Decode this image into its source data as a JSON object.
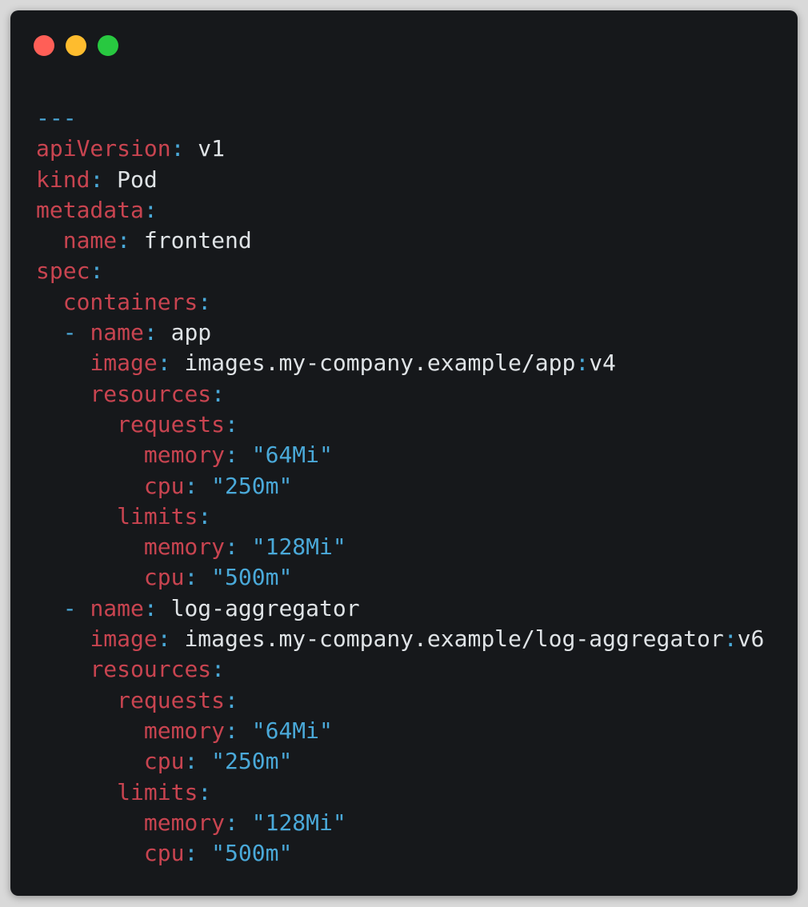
{
  "window": {
    "controls": [
      {
        "name": "close",
        "color": "#ff5f57"
      },
      {
        "name": "minimize",
        "color": "#febc2e"
      },
      {
        "name": "maximize",
        "color": "#28c840"
      }
    ]
  },
  "colors": {
    "background": "#16181b",
    "key": "#c84450",
    "punctuation": "#4aa9d9",
    "string": "#4aa9d9",
    "plain": "#dfe3e6"
  },
  "code": {
    "lines": [
      {
        "indent": "",
        "segments": [
          {
            "t": "punct",
            "v": "---"
          }
        ]
      },
      {
        "indent": "",
        "segments": [
          {
            "t": "key",
            "v": "apiVersion"
          },
          {
            "t": "punct",
            "v": ":"
          },
          {
            "t": "val",
            "v": " v1"
          }
        ]
      },
      {
        "indent": "",
        "segments": [
          {
            "t": "key",
            "v": "kind"
          },
          {
            "t": "punct",
            "v": ":"
          },
          {
            "t": "val",
            "v": " Pod"
          }
        ]
      },
      {
        "indent": "",
        "segments": [
          {
            "t": "key",
            "v": "metadata"
          },
          {
            "t": "punct",
            "v": ":"
          }
        ]
      },
      {
        "indent": "  ",
        "segments": [
          {
            "t": "key",
            "v": "name"
          },
          {
            "t": "punct",
            "v": ":"
          },
          {
            "t": "val",
            "v": " frontend"
          }
        ]
      },
      {
        "indent": "",
        "segments": [
          {
            "t": "key",
            "v": "spec"
          },
          {
            "t": "punct",
            "v": ":"
          }
        ]
      },
      {
        "indent": "  ",
        "segments": [
          {
            "t": "key",
            "v": "containers"
          },
          {
            "t": "punct",
            "v": ":"
          }
        ]
      },
      {
        "indent": "  ",
        "segments": [
          {
            "t": "punct",
            "v": "- "
          },
          {
            "t": "key",
            "v": "name"
          },
          {
            "t": "punct",
            "v": ":"
          },
          {
            "t": "val",
            "v": " app"
          }
        ]
      },
      {
        "indent": "    ",
        "segments": [
          {
            "t": "key",
            "v": "image"
          },
          {
            "t": "punct",
            "v": ":"
          },
          {
            "t": "val",
            "v": " images.my-company.example/app"
          },
          {
            "t": "punct",
            "v": ":"
          },
          {
            "t": "val",
            "v": "v4"
          }
        ]
      },
      {
        "indent": "    ",
        "segments": [
          {
            "t": "key",
            "v": "resources"
          },
          {
            "t": "punct",
            "v": ":"
          }
        ]
      },
      {
        "indent": "      ",
        "segments": [
          {
            "t": "key",
            "v": "requests"
          },
          {
            "t": "punct",
            "v": ":"
          }
        ]
      },
      {
        "indent": "        ",
        "segments": [
          {
            "t": "key",
            "v": "memory"
          },
          {
            "t": "punct",
            "v": ":"
          },
          {
            "t": "str",
            "v": " \"64Mi\""
          }
        ]
      },
      {
        "indent": "        ",
        "segments": [
          {
            "t": "key",
            "v": "cpu"
          },
          {
            "t": "punct",
            "v": ":"
          },
          {
            "t": "str",
            "v": " \"250m\""
          }
        ]
      },
      {
        "indent": "      ",
        "segments": [
          {
            "t": "key",
            "v": "limits"
          },
          {
            "t": "punct",
            "v": ":"
          }
        ]
      },
      {
        "indent": "        ",
        "segments": [
          {
            "t": "key",
            "v": "memory"
          },
          {
            "t": "punct",
            "v": ":"
          },
          {
            "t": "str",
            "v": " \"128Mi\""
          }
        ]
      },
      {
        "indent": "        ",
        "segments": [
          {
            "t": "key",
            "v": "cpu"
          },
          {
            "t": "punct",
            "v": ":"
          },
          {
            "t": "str",
            "v": " \"500m\""
          }
        ]
      },
      {
        "indent": "  ",
        "segments": [
          {
            "t": "punct",
            "v": "- "
          },
          {
            "t": "key",
            "v": "name"
          },
          {
            "t": "punct",
            "v": ":"
          },
          {
            "t": "val",
            "v": " log-aggregator"
          }
        ]
      },
      {
        "indent": "    ",
        "segments": [
          {
            "t": "key",
            "v": "image"
          },
          {
            "t": "punct",
            "v": ":"
          },
          {
            "t": "val",
            "v": " images.my-company.example/log-aggregator"
          },
          {
            "t": "punct",
            "v": ":"
          },
          {
            "t": "val",
            "v": "v6"
          }
        ]
      },
      {
        "indent": "    ",
        "segments": [
          {
            "t": "key",
            "v": "resources"
          },
          {
            "t": "punct",
            "v": ":"
          }
        ]
      },
      {
        "indent": "      ",
        "segments": [
          {
            "t": "key",
            "v": "requests"
          },
          {
            "t": "punct",
            "v": ":"
          }
        ]
      },
      {
        "indent": "        ",
        "segments": [
          {
            "t": "key",
            "v": "memory"
          },
          {
            "t": "punct",
            "v": ":"
          },
          {
            "t": "str",
            "v": " \"64Mi\""
          }
        ]
      },
      {
        "indent": "        ",
        "segments": [
          {
            "t": "key",
            "v": "cpu"
          },
          {
            "t": "punct",
            "v": ":"
          },
          {
            "t": "str",
            "v": " \"250m\""
          }
        ]
      },
      {
        "indent": "      ",
        "segments": [
          {
            "t": "key",
            "v": "limits"
          },
          {
            "t": "punct",
            "v": ":"
          }
        ]
      },
      {
        "indent": "        ",
        "segments": [
          {
            "t": "key",
            "v": "memory"
          },
          {
            "t": "punct",
            "v": ":"
          },
          {
            "t": "str",
            "v": " \"128Mi\""
          }
        ]
      },
      {
        "indent": "        ",
        "segments": [
          {
            "t": "key",
            "v": "cpu"
          },
          {
            "t": "punct",
            "v": ":"
          },
          {
            "t": "str",
            "v": " \"500m\""
          }
        ]
      }
    ]
  }
}
